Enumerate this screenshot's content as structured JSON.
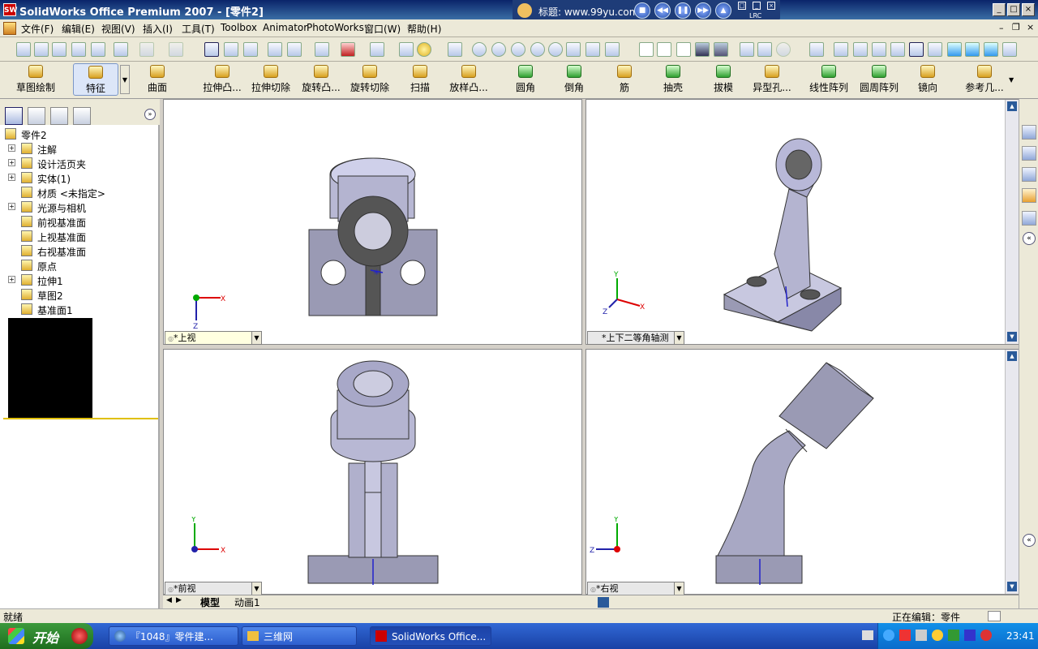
{
  "window": {
    "title": "SolidWorks Office Premium 2007 - [零件2]",
    "app_icon_text": "SW"
  },
  "player": {
    "title": "标题: www.99yu.com",
    "badge": "LRC"
  },
  "menubar": {
    "items": [
      "文件(F)",
      "编辑(E)",
      "视图(V)",
      "插入(I)",
      "工具(T)",
      "Toolbox",
      "Animator",
      "PhotoWorks",
      "窗口(W)",
      "帮助(H)"
    ]
  },
  "command_manager": {
    "tabs": [
      "草图绘制",
      "特征",
      "曲面"
    ],
    "commands": [
      "拉伸凸...",
      "拉伸切除",
      "旋转凸...",
      "旋转切除",
      "扫描",
      "放样凸...",
      "圆角",
      "倒角",
      "筋",
      "抽壳",
      "拔模",
      "异型孔...",
      "线性阵列",
      "圆周阵列",
      "镜向",
      "参考几..."
    ]
  },
  "feature_tree": {
    "root": "零件2",
    "items": [
      {
        "label": "注解",
        "expandable": true,
        "icon": "annotation-icon"
      },
      {
        "label": "设计活页夹",
        "expandable": true,
        "icon": "design-binder-icon"
      },
      {
        "label": "实体(1)",
        "expandable": true,
        "icon": "solid-bodies-icon"
      },
      {
        "label": "材质 <未指定>",
        "expandable": false,
        "icon": "material-icon"
      },
      {
        "label": "光源与相机",
        "expandable": true,
        "icon": "lights-cameras-icon"
      },
      {
        "label": "前视基准面",
        "expandable": false,
        "icon": "plane-icon"
      },
      {
        "label": "上视基准面",
        "expandable": false,
        "icon": "plane-icon"
      },
      {
        "label": "右视基准面",
        "expandable": false,
        "icon": "plane-icon"
      },
      {
        "label": "原点",
        "expandable": false,
        "icon": "origin-icon"
      },
      {
        "label": "拉伸1",
        "expandable": true,
        "icon": "extrude-icon"
      },
      {
        "label": "草图2",
        "expandable": false,
        "icon": "sketch-icon"
      },
      {
        "label": "基准面1",
        "expandable": false,
        "icon": "plane-icon"
      }
    ]
  },
  "viewports": {
    "top_left": "*上视",
    "top_right": "*上下二等角轴测",
    "bottom_left": "*前视",
    "bottom_right": "*右视"
  },
  "axis_labels": {
    "x": "X",
    "y": "Y",
    "z": "Z"
  },
  "sheet_tabs": [
    "模型",
    "动画1"
  ],
  "statusbar": {
    "left": "就绪",
    "right": "正在编辑：零件"
  },
  "taskbar": {
    "start": "开始",
    "tasks": [
      "『1048』零件建...",
      "三维网",
      "SolidWorks Office..."
    ],
    "clock": "23:41"
  },
  "colors": {
    "model_face": "#9a9ab4",
    "model_light": "#d0d0e8",
    "accent": "#0a246a"
  }
}
